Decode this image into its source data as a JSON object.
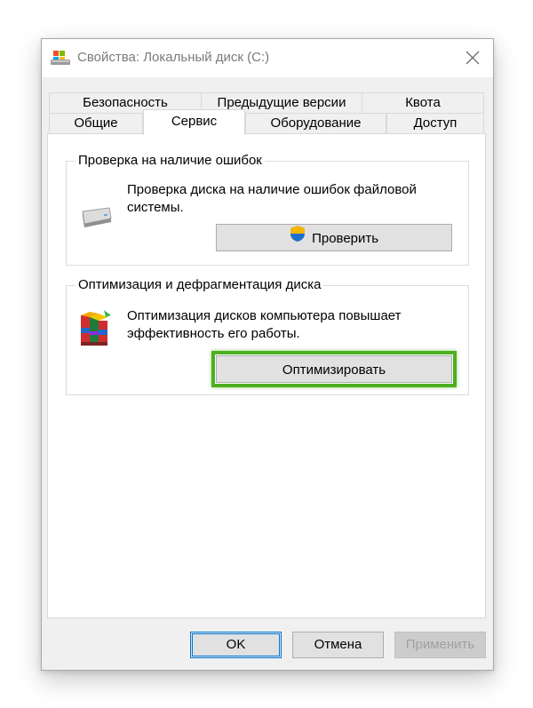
{
  "window": {
    "title": "Свойства: Локальный диск (C:)",
    "icon": "drive-icon",
    "close_icon": "close-icon"
  },
  "tabs": {
    "row_back": [
      {
        "label": "Безопасность"
      },
      {
        "label": "Предыдущие версии"
      },
      {
        "label": "Квота"
      }
    ],
    "row_front": [
      {
        "label": "Общие"
      },
      {
        "label": "Сервис",
        "active": true
      },
      {
        "label": "Оборудование"
      },
      {
        "label": "Доступ"
      }
    ]
  },
  "error_check": {
    "legend": "Проверка на наличие ошибок",
    "description": "Проверка диска на наличие ошибок файловой системы.",
    "button_label": "Проверить",
    "icon": "drive-icon",
    "button_icon": "uac-shield-icon"
  },
  "optimize": {
    "legend": "Оптимизация и дефрагментация диска",
    "description": "Оптимизация дисков компьютера повышает эффективность его работы.",
    "button_label": "Оптимизировать",
    "icon": "defrag-icon",
    "highlight_color": "#4caf1f"
  },
  "footer": {
    "ok_label": "OK",
    "cancel_label": "Отмена",
    "apply_label": "Применить",
    "apply_disabled": true
  },
  "colors": {
    "accent": "#0078d7",
    "highlight": "#4caf1f"
  }
}
